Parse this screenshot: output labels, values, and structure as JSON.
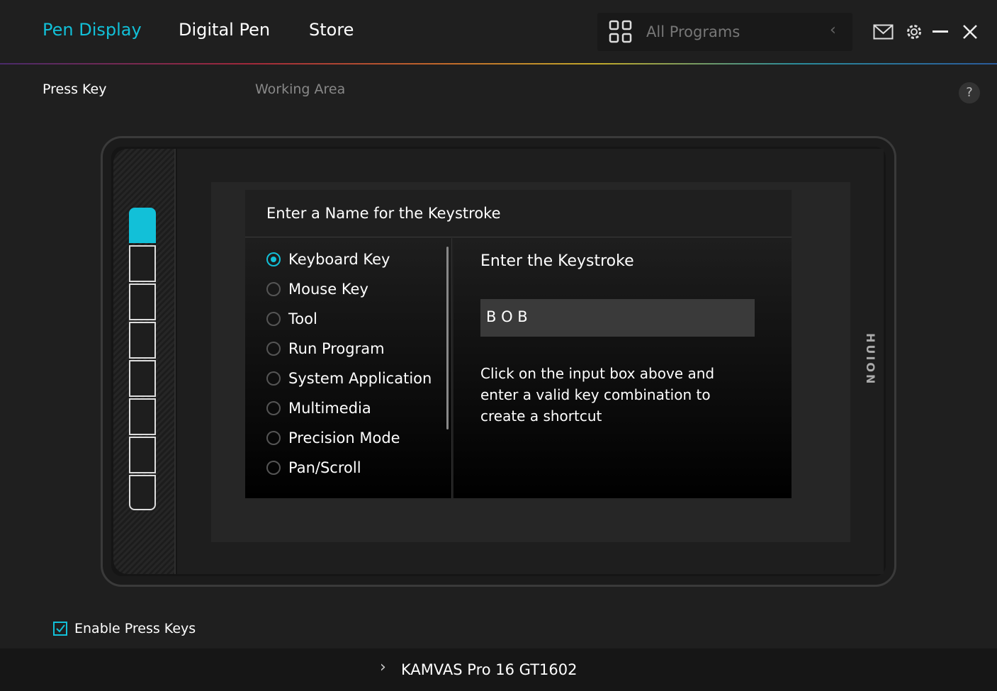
{
  "header": {
    "tabs": [
      {
        "label": "Pen Display",
        "active": true
      },
      {
        "label": "Digital Pen"
      },
      {
        "label": "Store"
      }
    ],
    "program_selector": {
      "label": "All Programs",
      "icon": "grid-icon"
    },
    "icons": [
      "mail-icon",
      "gear-icon",
      "minimize-icon",
      "close-icon"
    ]
  },
  "subtabs": [
    {
      "label": "Press Key",
      "active": true
    },
    {
      "label": "Working Area"
    }
  ],
  "help_label": "?",
  "accent": "#12c0d8",
  "tablet": {
    "brand": "HUION",
    "selected_key": 1,
    "key_count": 8
  },
  "dialog": {
    "title": "Enter a Name for the Keystroke",
    "options": [
      {
        "label": "Keyboard Key",
        "selected": true
      },
      {
        "label": "Mouse Key"
      },
      {
        "label": "Tool"
      },
      {
        "label": "Run Program"
      },
      {
        "label": "System Application"
      },
      {
        "label": "Multimedia"
      },
      {
        "label": "Precision Mode"
      },
      {
        "label": "Pan/Scroll"
      }
    ],
    "keystroke_heading": "Enter the Keystroke",
    "keystroke_value": "B O B",
    "hint": "Click on the input box above and enter a valid key combination to create a shortcut"
  },
  "enable_press_keys": {
    "label": "Enable Press Keys",
    "checked": true
  },
  "device": {
    "name": "KAMVAS Pro 16 GT1602"
  }
}
